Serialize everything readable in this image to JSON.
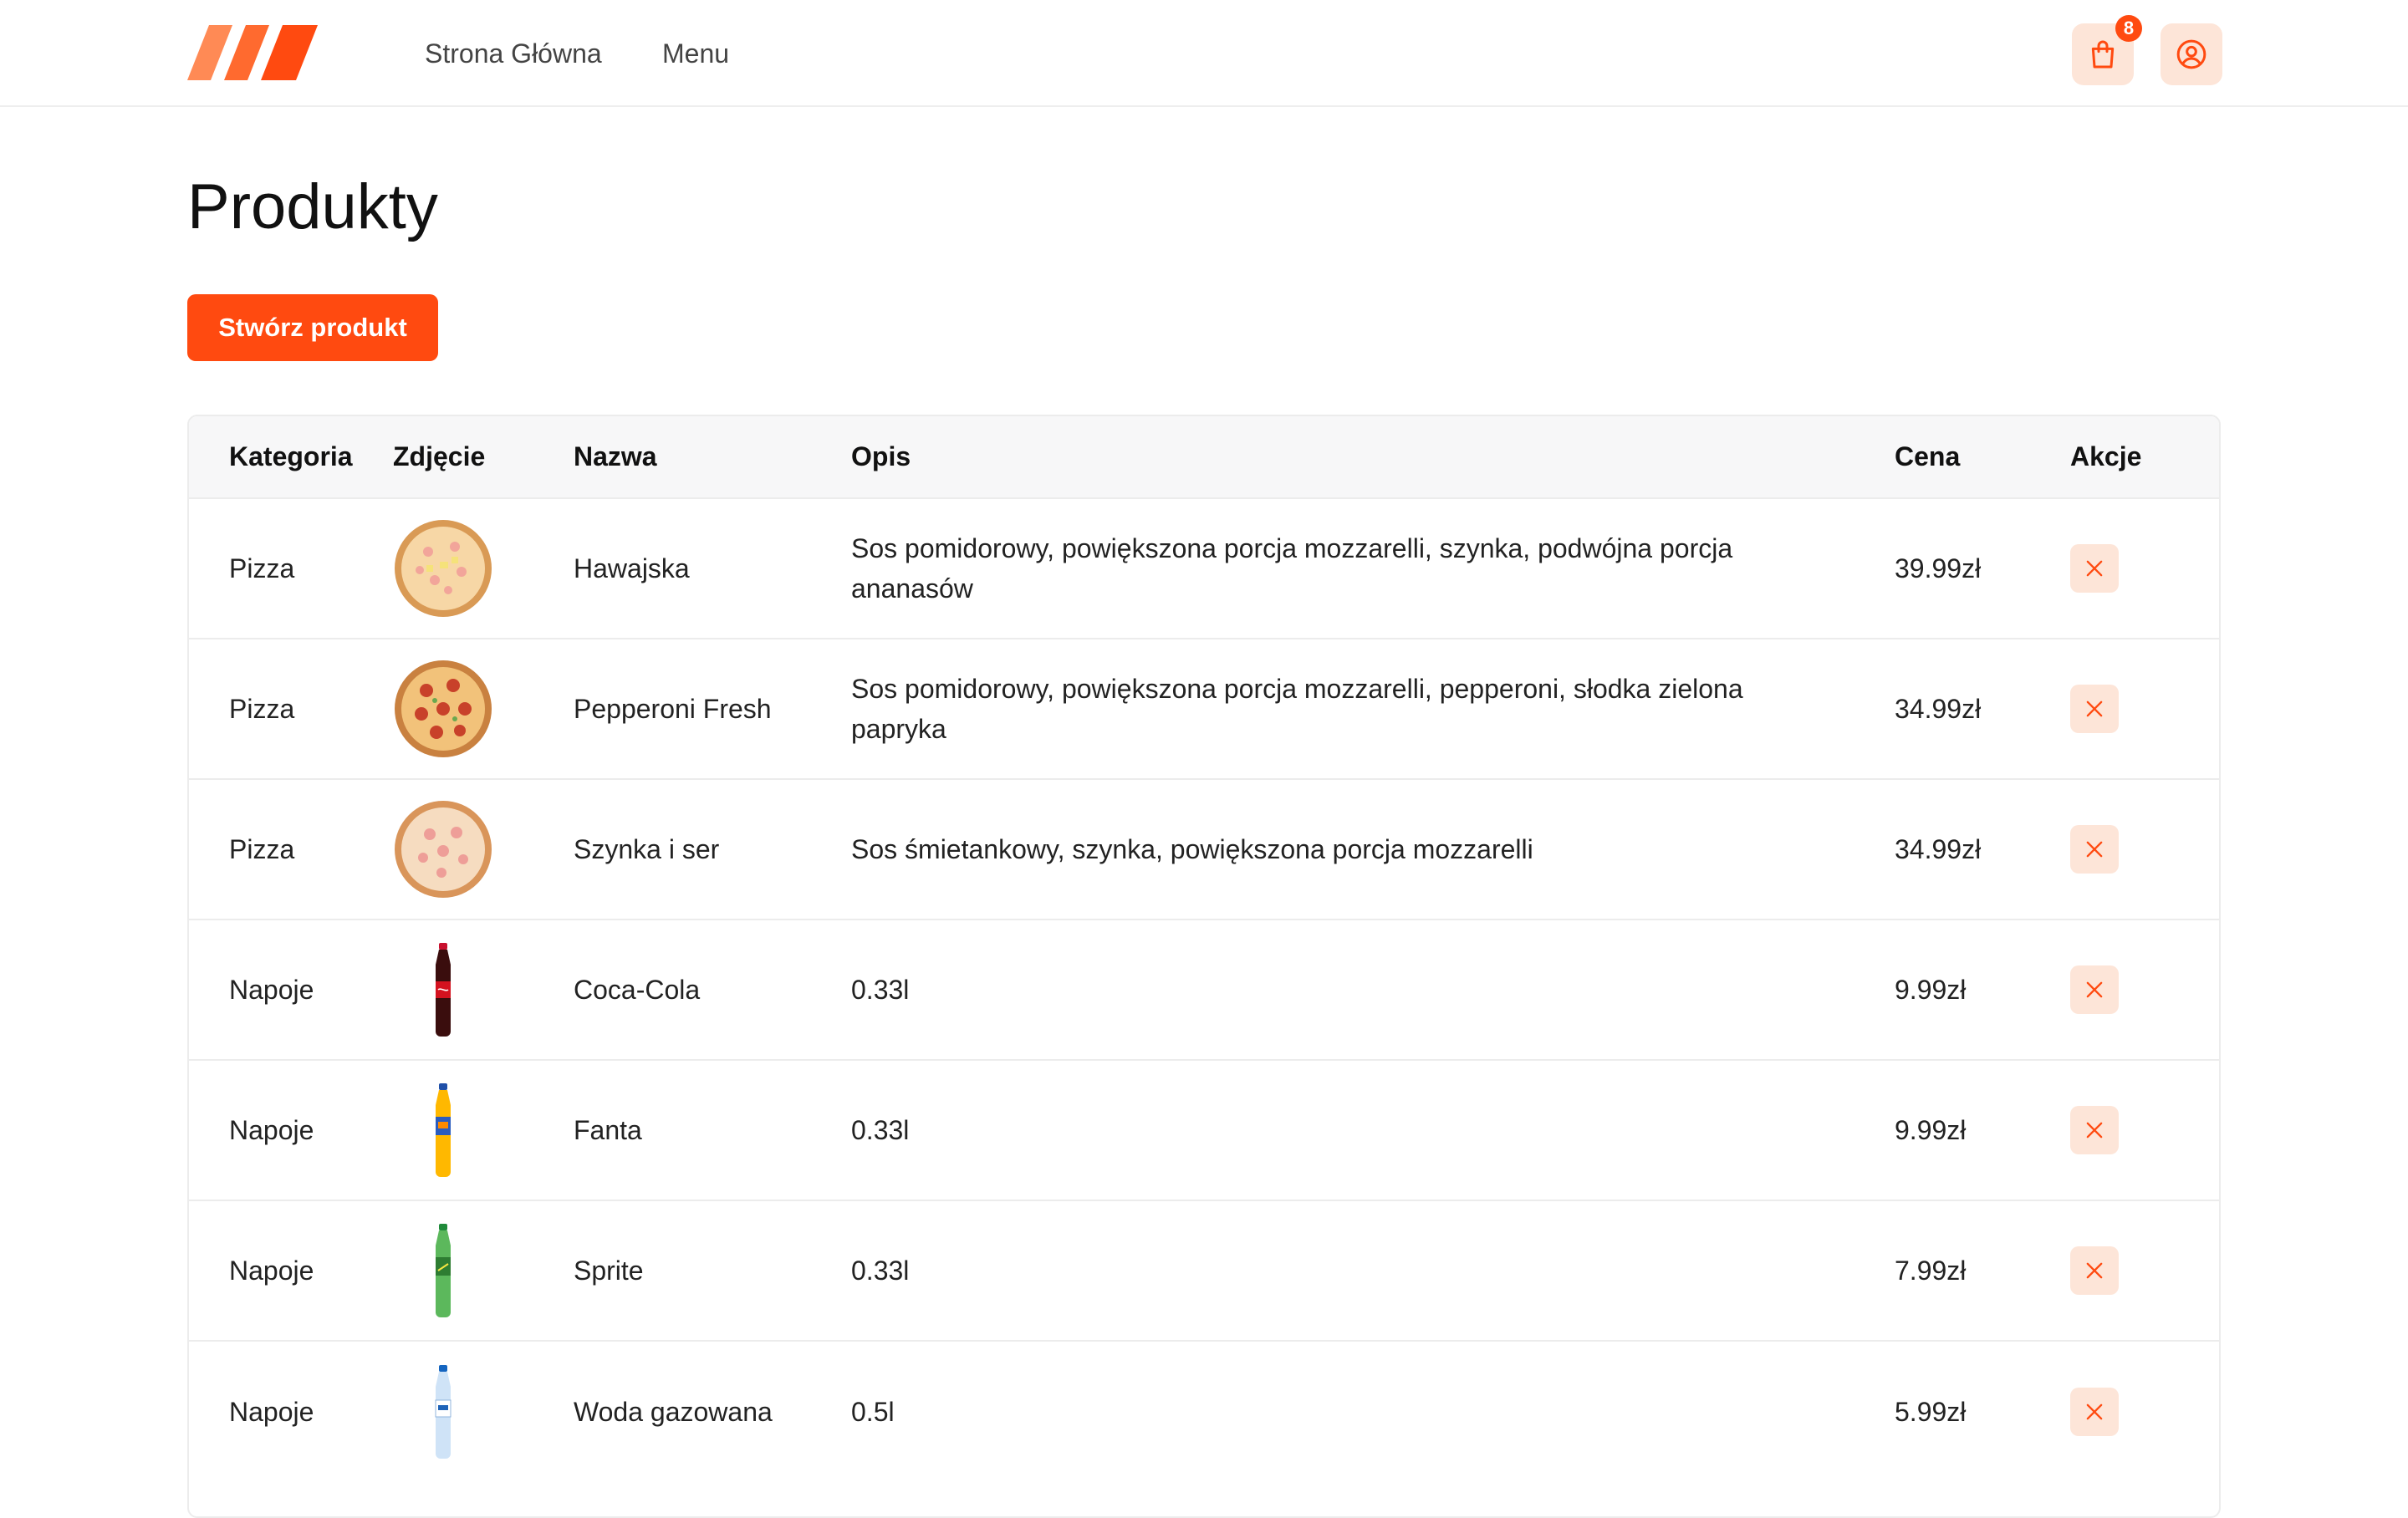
{
  "header": {
    "nav": [
      {
        "label": "Strona Główna"
      },
      {
        "label": "Menu"
      }
    ],
    "cart_count": "8"
  },
  "main": {
    "title": "Produkty",
    "create_button": "Stwórz produkt"
  },
  "table": {
    "headers": {
      "category": "Kategoria",
      "image": "Zdjęcie",
      "name": "Nazwa",
      "description": "Opis",
      "price": "Cena",
      "actions": "Akcje"
    },
    "rows": [
      {
        "category": "Pizza",
        "image": "pizza-hawaiian-image",
        "name": "Hawajska",
        "description": "Sos pomidorowy, powiększona porcja mozzarelli, szynka, podwójna porcja ananasów",
        "price": "39.99zł"
      },
      {
        "category": "Pizza",
        "image": "pizza-pepperoni-image",
        "name": "Pepperoni Fresh",
        "description": "Sos pomidorowy, powiększona porcja mozzarelli, pepperoni, słodka zielona papryka",
        "price": "34.99zł"
      },
      {
        "category": "Pizza",
        "image": "pizza-ham-cheese-image",
        "name": "Szynka i ser",
        "description": "Sos śmietankowy, szynka, powiększona porcja mozzarelli",
        "price": "34.99zł"
      },
      {
        "category": "Napoje",
        "image": "coca-cola-bottle-image",
        "name": "Coca-Cola",
        "description": "0.33l",
        "price": "9.99zł"
      },
      {
        "category": "Napoje",
        "image": "fanta-bottle-image",
        "name": "Fanta",
        "description": "0.33l",
        "price": "9.99zł"
      },
      {
        "category": "Napoje",
        "image": "sprite-bottle-image",
        "name": "Sprite",
        "description": "0.33l",
        "price": "7.99zł"
      },
      {
        "category": "Napoje",
        "image": "sparkling-water-bottle-image",
        "name": "Woda gazowana",
        "description": "0.5l",
        "price": "5.99zł"
      }
    ]
  },
  "colors": {
    "accent": "#ff4a10",
    "accent_soft": "#fde5d8",
    "border": "#ececec",
    "header_bg": "#f7f7f8"
  }
}
